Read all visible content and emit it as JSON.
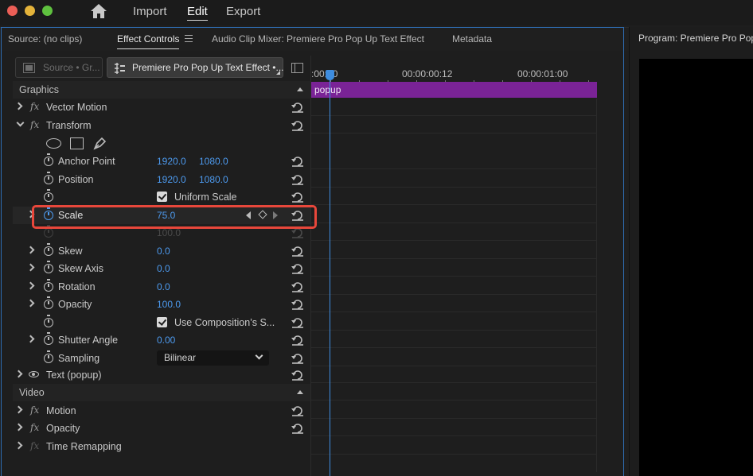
{
  "menubar": {
    "items": [
      {
        "label": "Import"
      },
      {
        "label": "Edit"
      },
      {
        "label": "Export"
      }
    ]
  },
  "panel_tabs": {
    "source": "Source: (no clips)",
    "effect_controls": "Effect Controls",
    "audio_mixer": "Audio Clip Mixer: Premiere Pro Pop Up Text Effect",
    "metadata": "Metadata"
  },
  "program": {
    "title": "Program: Premiere Pro Pop"
  },
  "source_select": {
    "master": "Source • Gr...",
    "sequence": "Premiere Pro Pop Up Text Effect •..."
  },
  "effects": {
    "graphics_header": "Graphics",
    "vector_motion": "Vector Motion",
    "transform": "Transform",
    "anchor_point": {
      "label": "Anchor Point",
      "x": "1920.0",
      "y": "1080.0"
    },
    "position": {
      "label": "Position",
      "x": "1920.0",
      "y": "1080.0"
    },
    "uniform_scale": "Uniform Scale",
    "scale": {
      "label": "Scale",
      "value": "75.0"
    },
    "scale_width": {
      "value": "100.0"
    },
    "skew": {
      "label": "Skew",
      "value": "0.0"
    },
    "skew_axis": {
      "label": "Skew Axis",
      "value": "0.0"
    },
    "rotation": {
      "label": "Rotation",
      "value": "0.0"
    },
    "opacity_t": {
      "label": "Opacity",
      "value": "100.0"
    },
    "use_comp_shutter": "Use Composition’s S...",
    "shutter_angle": {
      "label": "Shutter Angle",
      "value": "0.00"
    },
    "sampling": {
      "label": "Sampling",
      "value": "Bilinear"
    },
    "text_layer": "Text (popup)",
    "video_header": "Video",
    "motion": "Motion",
    "opacity": "Opacity",
    "time_remapping": "Time Remapping"
  },
  "timeline": {
    "ticks": [
      ":00:00",
      "00:00:00:12",
      "00:00:01:00"
    ],
    "clip_label": "popup"
  },
  "colors": {
    "accent_blue": "#4d9bf0",
    "clip_purple": "#7a2396",
    "highlight_red": "#e8473b"
  }
}
